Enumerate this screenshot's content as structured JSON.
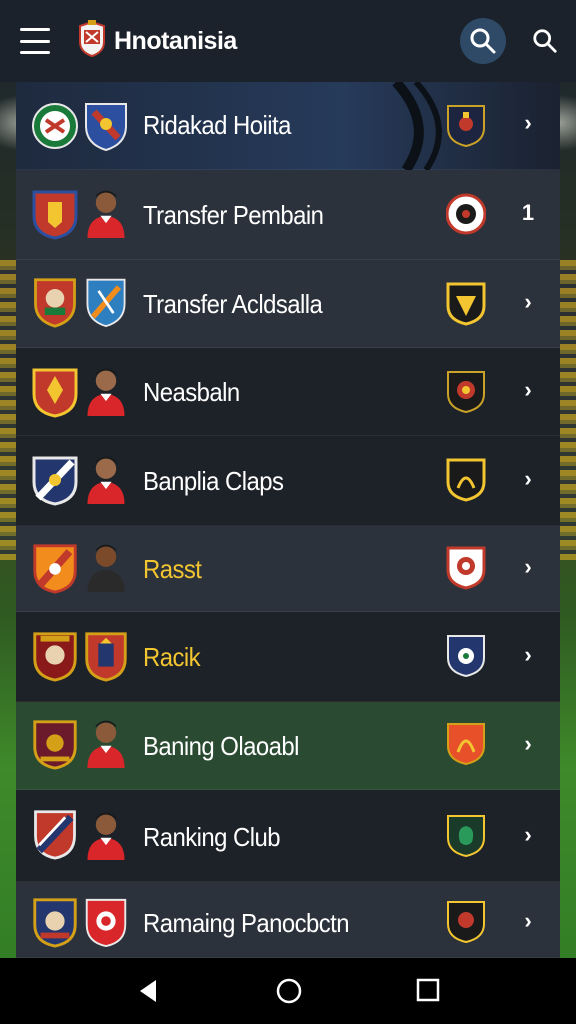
{
  "app": {
    "title": "Hnotanisia",
    "logo_icon": "club-crest-icon"
  },
  "toolbar": {
    "menu_icon": "hamburger-menu-icon",
    "search_active_icon": "search-icon",
    "search_icon": "search-icon"
  },
  "colors": {
    "appbar": "#1b222b",
    "row_dark": "#1d2128",
    "row_mid": "#2c323b",
    "row_blue": "#1e2a3e",
    "row_green": "#2a4a32",
    "accent_yellow": "#f2c531",
    "search_highlight": "#2e4a66"
  },
  "rows": [
    {
      "label": "Ridakad Hoiita",
      "chevron": "›",
      "label_color": "#ffffff"
    },
    {
      "label": "Transfer Pembain",
      "chevron": "1",
      "label_color": "#ffffff"
    },
    {
      "label": "Transfer Acldsalla",
      "chevron": "›",
      "label_color": "#ffffff"
    },
    {
      "label": "Neasbaln",
      "chevron": "›",
      "label_color": "#ffffff"
    },
    {
      "label": "Banplia Claps",
      "chevron": "›",
      "label_color": "#ffffff"
    },
    {
      "label": "Rasst",
      "chevron": "›",
      "label_color": "#f2c531"
    },
    {
      "label": "Racik",
      "chevron": "›",
      "label_color": "#f2c531"
    },
    {
      "label": "Baning Olaoabl",
      "chevron": "›",
      "label_color": "#ffffff"
    },
    {
      "label": "Ranking Club",
      "chevron": "›",
      "label_color": "#ffffff"
    },
    {
      "label": "Ramaing Panocbctn",
      "chevron": "›",
      "label_color": "#ffffff"
    }
  ],
  "navbar": {
    "back_icon": "back-triangle-icon",
    "home_icon": "home-circle-icon",
    "recents_icon": "recents-square-icon"
  }
}
